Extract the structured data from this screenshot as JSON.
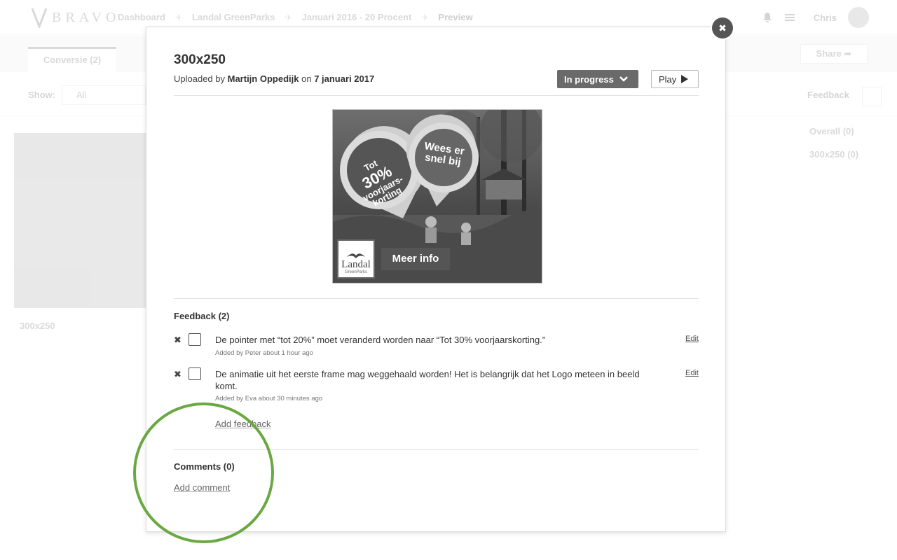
{
  "app": {
    "logo_text": "BRAVO",
    "breadcrumbs": [
      "Dashboard",
      "Landal GreenParks",
      "Januari 2016 - 20 Procent",
      "Preview"
    ],
    "user_name": "Chris"
  },
  "subbar": {
    "tab_label": "Conversie (2)",
    "share_label": "Share"
  },
  "filter": {
    "show_label": "Show:",
    "show_value": "All",
    "feedback_panel_label": "Feedback"
  },
  "side_list": {
    "items": [
      "Overall (0)",
      "300x250 (0)"
    ]
  },
  "background_thumb": {
    "label": "300x250"
  },
  "modal": {
    "title": "300x250",
    "uploaded_prefix": "Uploaded by",
    "uploader": "Martijn Oppedijk",
    "on_text": "on",
    "upload_date": "7 januari 2017",
    "status_label": "In progress",
    "play_label": "Play",
    "close_glyph": "✖"
  },
  "banner": {
    "pin1_line1": "Tot",
    "pin1_big": "30%",
    "pin1_line2": "voorjaars-",
    "pin1_line3": "korting",
    "pin2_line1": "Wees er",
    "pin2_line2": "snel bij",
    "logo_text": "Landal",
    "logo_sub": "GreenParks",
    "cta_label": "Meer info"
  },
  "feedback": {
    "heading": "Feedback (2)",
    "items": [
      {
        "text": "De pointer met “tot 20%” moet veranderd worden naar “Tot 30% voorjaarskorting.”",
        "meta": "Added by Peter about 1 hour ago",
        "edit_label": "Edit"
      },
      {
        "text": "De animatie uit het eerste frame mag weggehaald worden! Het is belangrijk dat het Logo meteen in beeld komt.",
        "meta": "Added by Eva about 30 minutes ago",
        "edit_label": "Edit"
      }
    ],
    "add_label": "Add feedback"
  },
  "comments": {
    "heading": "Comments (0)",
    "add_label": "Add comment"
  },
  "colors": {
    "highlight": "#6aa841",
    "status_bg": "#6a6a6a"
  }
}
